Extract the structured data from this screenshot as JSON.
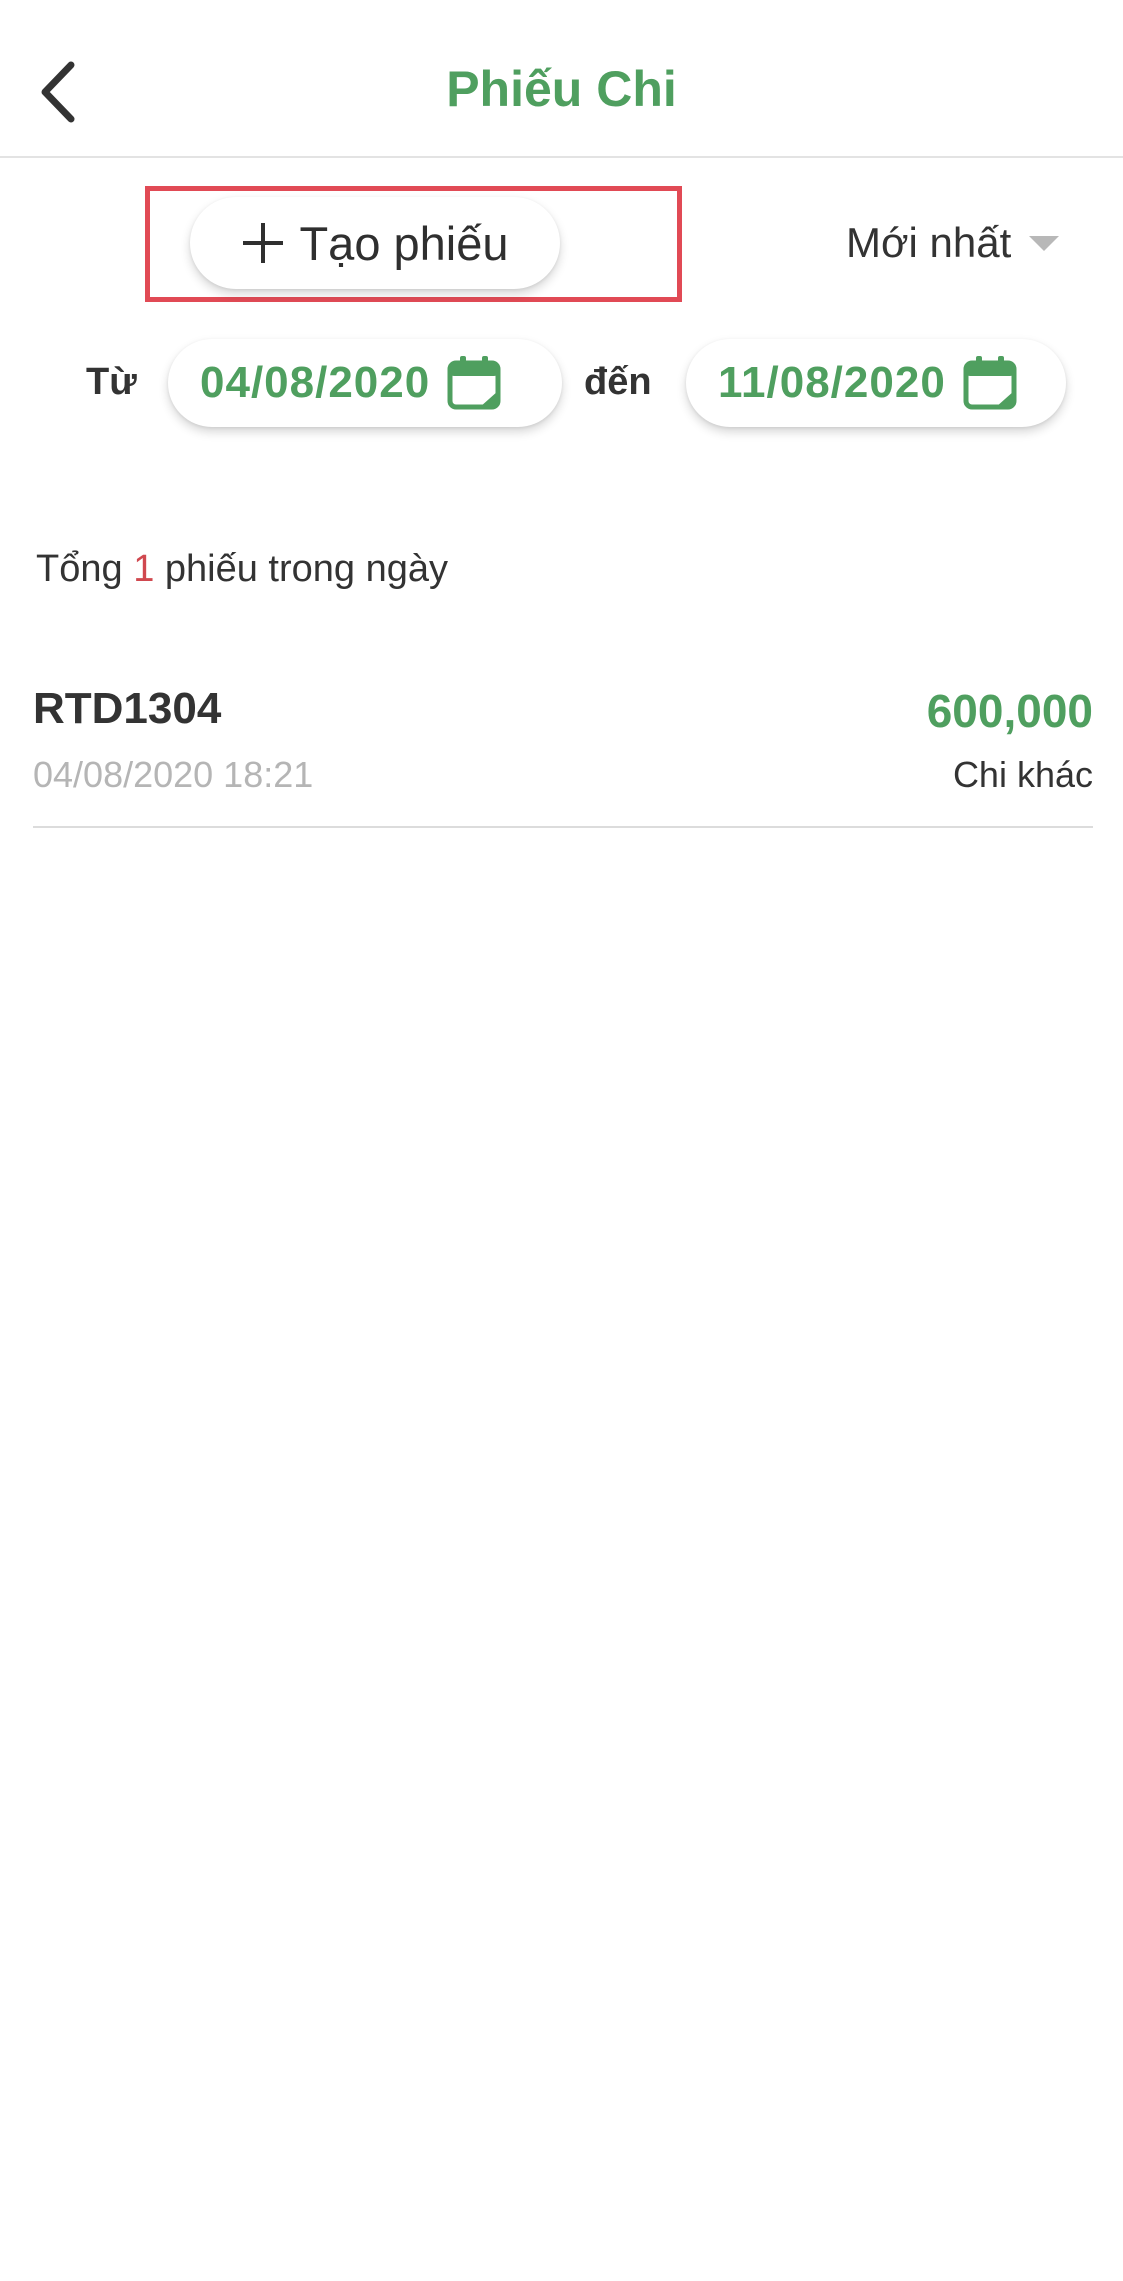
{
  "header": {
    "title": "Phiếu Chi",
    "back_icon": "chevron-left-icon"
  },
  "toolbar": {
    "create_label": "Tạo phiếu",
    "create_icon": "plus-icon",
    "sort_label": "Mới nhất",
    "sort_icon": "caret-down-icon"
  },
  "date_filter": {
    "from_label": "Từ",
    "from_value": "04/08/2020",
    "to_label": "đến",
    "to_value": "11/08/2020",
    "icon": "calendar-icon"
  },
  "summary": {
    "prefix": "Tổng",
    "count": "1",
    "suffix": "phiếu trong ngày"
  },
  "items": [
    {
      "code": "RTD1304",
      "datetime": "04/08/2020 18:21",
      "amount": "600,000",
      "type": "Chi khác"
    }
  ],
  "colors": {
    "accent": "#4f9f5f",
    "highlight_border": "#e14a55",
    "count_red": "#d0484f",
    "muted_text": "#b5b5b5"
  }
}
